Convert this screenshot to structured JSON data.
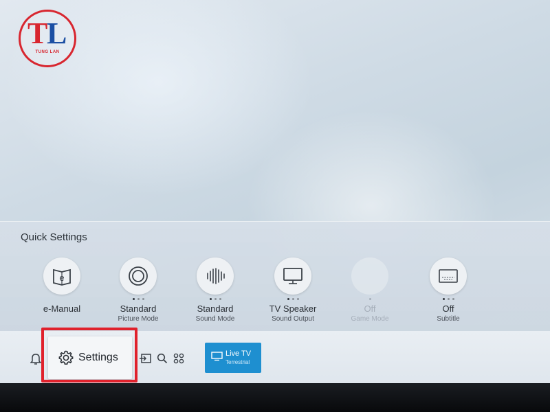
{
  "logo": {
    "letter_t": "T",
    "letter_l": "L",
    "text": "TUNG LAN"
  },
  "quick_settings": {
    "title": "Quick Settings",
    "items": [
      {
        "label": "e-Manual",
        "sub": "",
        "icon": "book-icon",
        "dots": 0,
        "active": -1,
        "disabled": false
      },
      {
        "label": "Standard",
        "sub": "Picture Mode",
        "icon": "picture-mode-icon",
        "dots": 3,
        "active": 0,
        "disabled": false
      },
      {
        "label": "Standard",
        "sub": "Sound Mode",
        "icon": "sound-mode-icon",
        "dots": 3,
        "active": 0,
        "disabled": false
      },
      {
        "label": "TV Speaker",
        "sub": "Sound Output",
        "icon": "tv-speaker-icon",
        "dots": 3,
        "active": 0,
        "disabled": false
      },
      {
        "label": "Off",
        "sub": "Game Mode",
        "icon": "game-mode-icon",
        "dots": 1,
        "active": 0,
        "disabled": true
      },
      {
        "label": "Off",
        "sub": "Subtitle",
        "icon": "subtitle-icon",
        "dots": 3,
        "active": 0,
        "disabled": false
      }
    ]
  },
  "bottom_bar": {
    "settings_label": "Settings",
    "live_tv": {
      "title": "Live TV",
      "sub": "Terrestrial"
    }
  },
  "colors": {
    "highlight": "#e0212c",
    "live_tv": "#1e8fd0"
  }
}
